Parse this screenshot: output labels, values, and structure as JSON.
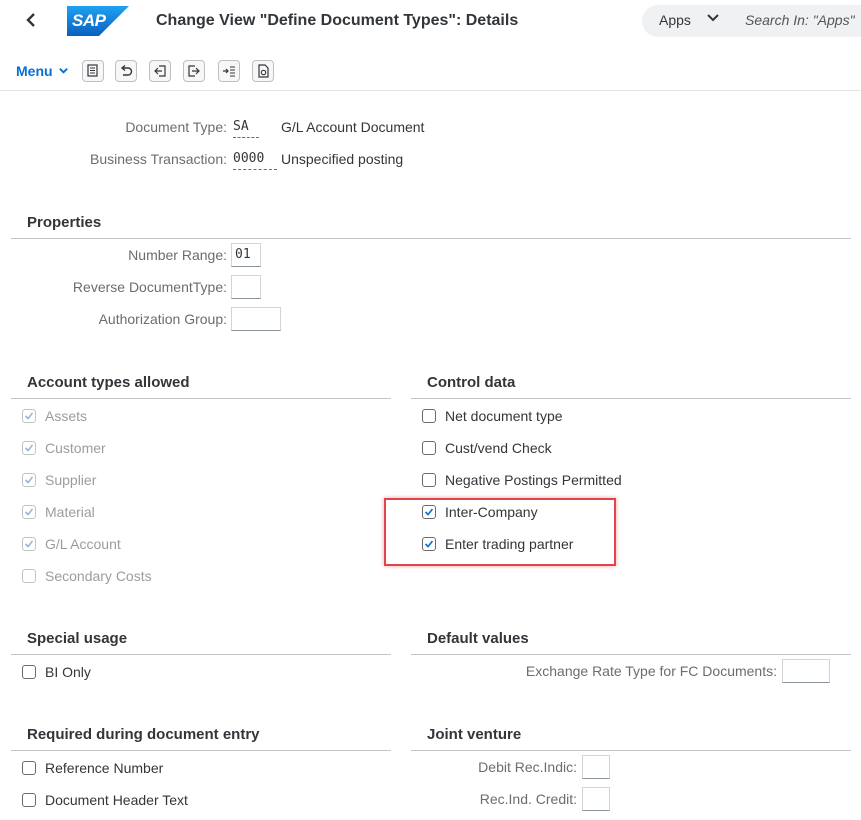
{
  "header": {
    "back_icon": "chevron-left-icon",
    "logo": "SAP",
    "title": "Change View \"Define Document Types\": Details",
    "apps_label": "Apps",
    "search_placeholder": "Search In: \"Apps\""
  },
  "toolbar": {
    "menu_label": "Menu",
    "buttons": [
      "copy-icon",
      "undo-icon",
      "previous-entry-icon",
      "next-entry-icon",
      "expand-icon",
      "details-icon"
    ]
  },
  "fields": {
    "document_type": {
      "label": "Document Type:",
      "value": "SA",
      "description": "G/L Account Document"
    },
    "business_transaction": {
      "label": "Business Transaction:",
      "value": "0000",
      "description": "Unspecified posting"
    }
  },
  "properties": {
    "title": "Properties",
    "number_range": {
      "label": "Number Range:",
      "value": "01"
    },
    "reverse_doc_type": {
      "label": "Reverse DocumentType:",
      "value": ""
    },
    "authorization_group": {
      "label": "Authorization Group:",
      "value": ""
    }
  },
  "account_types": {
    "title": "Account types allowed",
    "items": [
      {
        "label": "Assets",
        "checked": true,
        "disabled": true
      },
      {
        "label": "Customer",
        "checked": true,
        "disabled": true
      },
      {
        "label": "Supplier",
        "checked": true,
        "disabled": true
      },
      {
        "label": "Material",
        "checked": true,
        "disabled": true
      },
      {
        "label": "G/L Account",
        "checked": true,
        "disabled": true
      },
      {
        "label": "Secondary Costs",
        "checked": false,
        "disabled": true
      }
    ]
  },
  "control_data": {
    "title": "Control data",
    "items": [
      {
        "label": "Net document type",
        "checked": false
      },
      {
        "label": "Cust/vend Check",
        "checked": false
      },
      {
        "label": "Negative Postings Permitted",
        "checked": false
      },
      {
        "label": "Inter-Company",
        "checked": true
      },
      {
        "label": "Enter trading partner",
        "checked": true
      }
    ]
  },
  "special_usage": {
    "title": "Special usage",
    "items": [
      {
        "label": "BI Only",
        "checked": false
      }
    ]
  },
  "default_values": {
    "title": "Default values",
    "exchange_rate": {
      "label": "Exchange Rate Type for FC Documents:",
      "value": ""
    }
  },
  "required_entry": {
    "title": "Required during document entry",
    "items": [
      {
        "label": "Reference Number",
        "checked": false
      },
      {
        "label": "Document Header Text",
        "checked": false
      }
    ]
  },
  "joint_venture": {
    "title": "Joint venture",
    "debit_rec": {
      "label": "Debit Rec.Indic:",
      "value": ""
    },
    "credit_rec": {
      "label": "Rec.Ind. Credit:",
      "value": ""
    }
  },
  "colors": {
    "brand_blue": "#0a6ed1",
    "highlight_red": "#e0454a",
    "text": "#32363a",
    "label_grey": "#6a6d70"
  }
}
